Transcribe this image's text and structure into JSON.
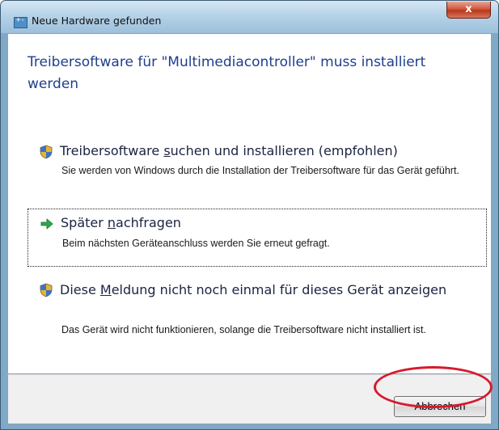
{
  "window": {
    "title": "Neue Hardware gefunden",
    "close_label": "x"
  },
  "dialog": {
    "heading": "Treibersoftware für \"Multimediacontroller\" muss installiert werden"
  },
  "options": [
    {
      "icon": "shield-icon",
      "title_before": "Treibersoftware ",
      "title_access": "s",
      "title_after": "uchen und installieren (empfohlen)",
      "description": "Sie werden von Windows durch die Installation der Treibersoftware für das Gerät geführt."
    },
    {
      "icon": "green-arrow-icon",
      "title_before": "Später ",
      "title_access": "n",
      "title_after": "achfragen",
      "description": "Beim nächsten Geräteanschluss werden Sie erneut gefragt."
    },
    {
      "icon": "shield-icon",
      "title_before": "Diese ",
      "title_access": "M",
      "title_after": "eldung nicht noch einmal für dieses Gerät anzeigen",
      "description": "Das Gerät wird nicht funktionieren, solange die Treibersoftware nicht installiert ist."
    }
  ],
  "footer": {
    "cancel_label": "Abbrechen"
  },
  "colors": {
    "heading": "#1e3f8c",
    "highlight_ring": "#d61a2e",
    "close_button": "#c8452b"
  }
}
